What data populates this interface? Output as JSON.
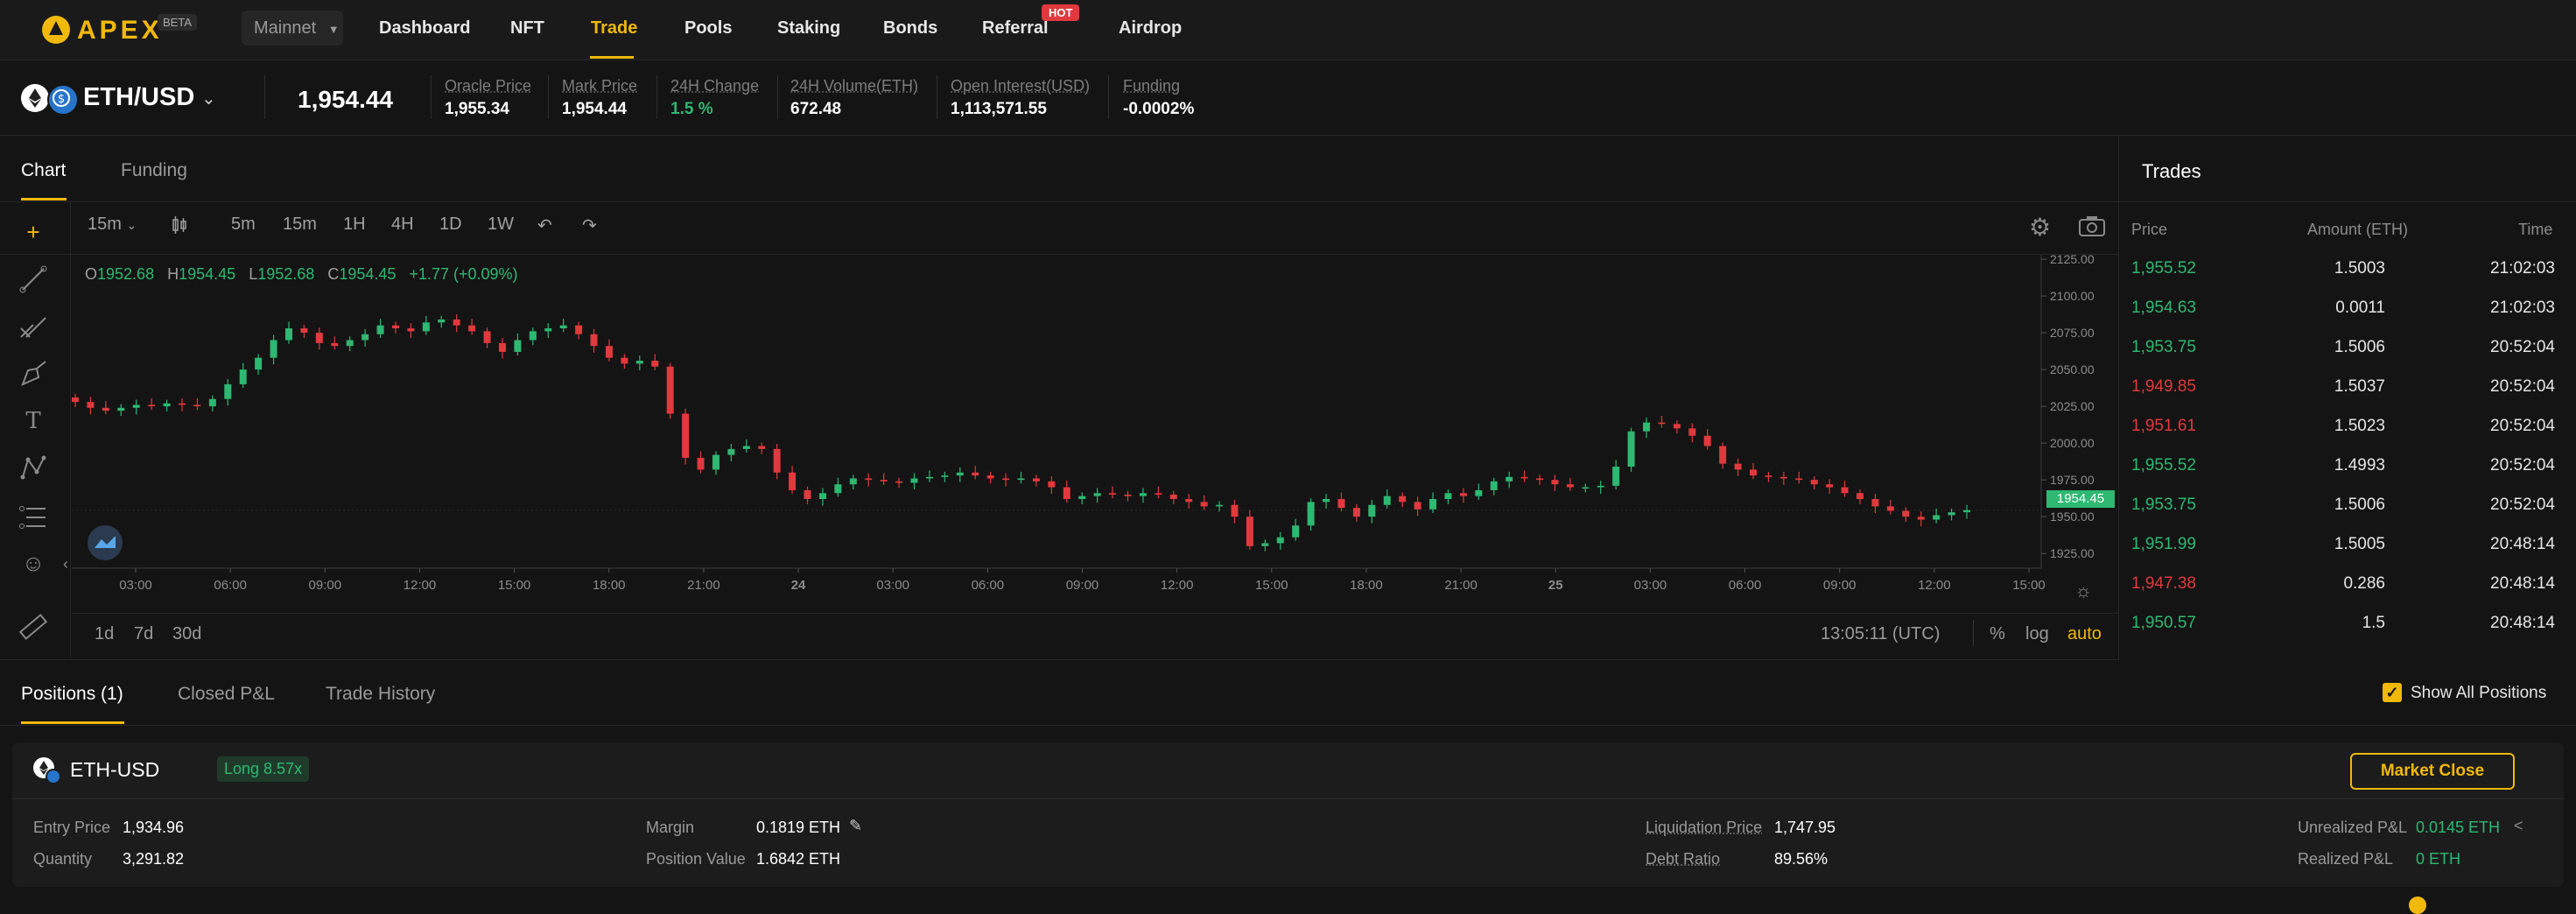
{
  "brand": {
    "name": "APEX",
    "badge": "BETA",
    "accent": "#f0b90b"
  },
  "network": {
    "selected": "Mainnet"
  },
  "nav": [
    {
      "label": "Dashboard"
    },
    {
      "label": "NFT"
    },
    {
      "label": "Trade",
      "active": true
    },
    {
      "label": "Pools"
    },
    {
      "label": "Staking"
    },
    {
      "label": "Bonds"
    },
    {
      "label": "Referral",
      "badge": "HOT"
    },
    {
      "label": "Airdrop"
    }
  ],
  "ticker": {
    "pair": "ETH/USD",
    "last_price": "1,954.44",
    "stats": [
      {
        "label": "Oracle Price",
        "value": "1,955.34"
      },
      {
        "label": "Mark Price",
        "value": "1,954.44"
      },
      {
        "label": "24H Change",
        "value": "1.5 %"
      },
      {
        "label": "24H Volume(ETH)",
        "value": "672.48"
      },
      {
        "label": "Open Interest(USD)",
        "value": "1,113,571.55"
      },
      {
        "label": "Funding",
        "value": "-0.0002%"
      }
    ]
  },
  "chart_panel": {
    "tabs": [
      "Chart",
      "Funding"
    ],
    "interval_select": "15m",
    "timeframes": [
      "5m",
      "15m",
      "1H",
      "4H",
      "1D",
      "1W"
    ],
    "ohlc": {
      "o_label": "O",
      "o": "1952.68",
      "h_label": "H",
      "h": "1954.45",
      "l_label": "L",
      "l": "1952.68",
      "c_label": "C",
      "c": "1954.45",
      "change": "+1.77 (+0.09%)"
    },
    "current_price_tag": "1954.45",
    "ranges": [
      "1d",
      "7d",
      "30d"
    ],
    "clock": "13:05:11 (UTC)",
    "scale_options": [
      "%",
      "log",
      "auto"
    ]
  },
  "chart_data": {
    "type": "candlestick",
    "y_ticks": [
      "2125.00",
      "2100.00",
      "2075.00",
      "2050.00",
      "2025.00",
      "2000.00",
      "1975.00",
      "1950.00",
      "1925.00"
    ],
    "ylim": [
      1915,
      2128
    ],
    "x_ticks": [
      "03:00",
      "06:00",
      "09:00",
      "12:00",
      "15:00",
      "18:00",
      "21:00",
      "24",
      "03:00",
      "06:00",
      "09:00",
      "12:00",
      "15:00",
      "18:00",
      "21:00",
      "25",
      "03:00",
      "06:00",
      "09:00",
      "12:00",
      "15:00"
    ],
    "close_series": [
      2028,
      2024,
      2022,
      2024,
      2026,
      2025,
      2027,
      2026,
      2025,
      2030,
      2040,
      2050,
      2058,
      2070,
      2078,
      2075,
      2068,
      2066,
      2070,
      2074,
      2080,
      2078,
      2076,
      2082,
      2084,
      2080,
      2076,
      2068,
      2062,
      2070,
      2076,
      2078,
      2080,
      2074,
      2066,
      2058,
      2054,
      2056,
      2052,
      2020,
      1990,
      1982,
      1992,
      1996,
      1998,
      1996,
      1980,
      1968,
      1962,
      1966,
      1972,
      1976,
      1975,
      1974,
      1973,
      1976,
      1977,
      1978,
      1980,
      1978,
      1976,
      1975,
      1976,
      1974,
      1970,
      1962,
      1964,
      1966,
      1965,
      1964,
      1966,
      1965,
      1962,
      1960,
      1957,
      1958,
      1950,
      1930,
      1932,
      1936,
      1944,
      1960,
      1962,
      1956,
      1950,
      1958,
      1964,
      1960,
      1955,
      1962,
      1966,
      1964,
      1968,
      1974,
      1977,
      1976,
      1975,
      1972,
      1970,
      1970,
      1971,
      1984,
      2008,
      2014,
      2013,
      2010,
      2005,
      1998,
      1986,
      1982,
      1978,
      1977,
      1976,
      1975,
      1972,
      1970,
      1966,
      1962,
      1957,
      1954,
      1950,
      1948,
      1951,
      1953,
      1954.45
    ]
  },
  "trades": {
    "title": "Trades",
    "headers": [
      "Price",
      "Amount (ETH)",
      "Time"
    ],
    "rows": [
      {
        "price": "1,955.52",
        "side": "buy",
        "amount": "1.5003",
        "time": "21:02:03"
      },
      {
        "price": "1,954.63",
        "side": "buy",
        "amount": "0.0011",
        "time": "21:02:03"
      },
      {
        "price": "1,953.75",
        "side": "buy",
        "amount": "1.5006",
        "time": "20:52:04"
      },
      {
        "price": "1,949.85",
        "side": "sell",
        "amount": "1.5037",
        "time": "20:52:04"
      },
      {
        "price": "1,951.61",
        "side": "sell",
        "amount": "1.5023",
        "time": "20:52:04"
      },
      {
        "price": "1,955.52",
        "side": "buy",
        "amount": "1.4993",
        "time": "20:52:04"
      },
      {
        "price": "1,953.75",
        "side": "buy",
        "amount": "1.5006",
        "time": "20:52:04"
      },
      {
        "price": "1,951.99",
        "side": "buy",
        "amount": "1.5005",
        "time": "20:48:14"
      },
      {
        "price": "1,947.38",
        "side": "sell",
        "amount": "0.286",
        "time": "20:48:14"
      },
      {
        "price": "1,950.57",
        "side": "buy",
        "amount": "1.5",
        "time": "20:48:14"
      }
    ]
  },
  "positions": {
    "tabs": [
      "Positions (1)",
      "Closed P&L",
      "Trade History"
    ],
    "show_all_label": "Show All Positions",
    "pair": "ETH-USD",
    "leverage_badge": "Long 8.57x",
    "market_close_label": "Market Close",
    "entry_price_label": "Entry Price",
    "entry_price": "1,934.96",
    "quantity_label": "Quantity",
    "quantity": "3,291.82",
    "margin_label": "Margin",
    "margin": "0.1819 ETH",
    "position_value_label": "Position Value",
    "position_value": "1.6842 ETH",
    "liq_price_label": "Liquidation Price",
    "liq_price": "1,747.95",
    "debt_ratio_label": "Debt Ratio",
    "debt_ratio": "89.56%",
    "unrealized_label": "Unrealized P&L",
    "unrealized": "0.0145 ETH",
    "realized_label": "Realized P&L",
    "realized": "0 ETH"
  },
  "colors": {
    "up": "#2eb872",
    "down": "#e0393e",
    "accent": "#f0b90b"
  }
}
